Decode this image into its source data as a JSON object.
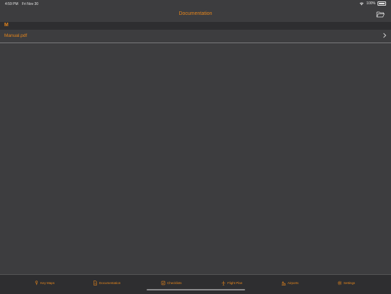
{
  "status_bar": {
    "time": "4:59 PM",
    "date": "Fri Nov 30",
    "battery": "100%"
  },
  "nav": {
    "title": "Documentation",
    "folder_icon": "folder-icon"
  },
  "section": {
    "letter": "M"
  },
  "documents": [
    {
      "name": "Manual.pdf"
    }
  ],
  "tabs": [
    {
      "label": "Key Maps",
      "icon": "key-maps-icon"
    },
    {
      "label": "Documentation",
      "icon": "document-icon"
    },
    {
      "label": "Checklists",
      "icon": "checklist-icon"
    },
    {
      "label": "Flight Plan",
      "icon": "plane-icon"
    },
    {
      "label": "Airports",
      "icon": "airport-icon"
    },
    {
      "label": "Settings",
      "icon": "gear-icon"
    }
  ],
  "colors": {
    "accent": "#e6861c",
    "background": "#3d3d3f",
    "bar": "#2e2e30"
  }
}
